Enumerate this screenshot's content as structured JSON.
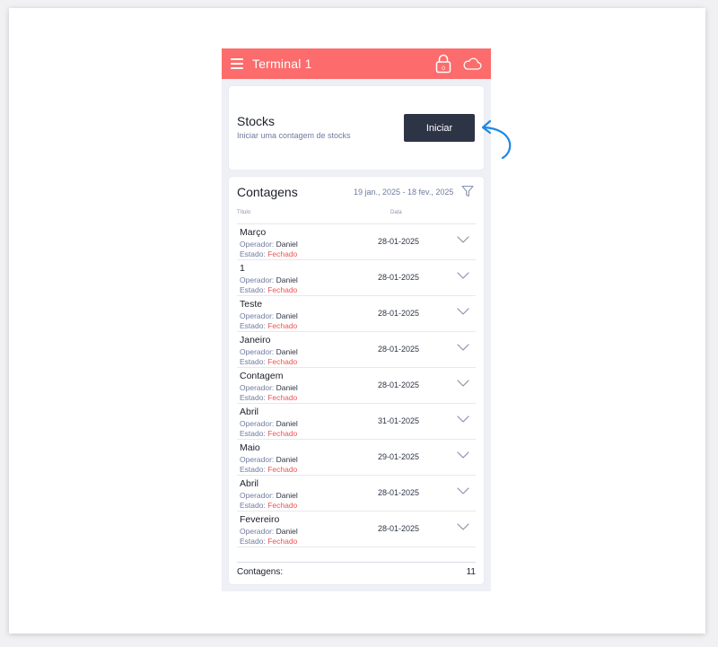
{
  "header": {
    "title": "Terminal 1",
    "lock_badge": "0"
  },
  "stocks": {
    "title": "Stocks",
    "subtitle": "Iniciar uma contagem de stocks",
    "start_label": "Iniciar"
  },
  "counts": {
    "title": "Contagens",
    "date_range": "19 jan., 2025 - 18 fev., 2025",
    "col_title": "Título",
    "col_date": "Data",
    "operator_label": "Operador:",
    "state_label": "Estado:",
    "rows": [
      {
        "title": "Março",
        "operator": "Daniel",
        "state": "Fechado",
        "date": "28-01-2025"
      },
      {
        "title": "1",
        "operator": "Daniel",
        "state": "Fechado",
        "date": "28-01-2025"
      },
      {
        "title": "Teste",
        "operator": "Daniel",
        "state": "Fechado",
        "date": "28-01-2025"
      },
      {
        "title": "Janeiro",
        "operator": "Daniel",
        "state": "Fechado",
        "date": "28-01-2025"
      },
      {
        "title": "Contagem",
        "operator": "Daniel",
        "state": "Fechado",
        "date": "28-01-2025"
      },
      {
        "title": "Abril",
        "operator": "Daniel",
        "state": "Fechado",
        "date": "31-01-2025"
      },
      {
        "title": "Maio",
        "operator": "Daniel",
        "state": "Fechado",
        "date": "29-01-2025"
      },
      {
        "title": "Abril",
        "operator": "Daniel",
        "state": "Fechado",
        "date": "28-01-2025"
      },
      {
        "title": "Fevereiro",
        "operator": "Daniel",
        "state": "Fechado",
        "date": "28-01-2025"
      }
    ],
    "footer_label": "Contagens:",
    "footer_count": "11"
  },
  "colors": {
    "header": "#fc6c6c",
    "button": "#2d3446",
    "closed": "#f05252",
    "arrow": "#1e88e5"
  },
  "icons": [
    "menu-icon",
    "lock-icon",
    "cloud-icon",
    "filter-icon",
    "chevron-down-icon",
    "curved-arrow-icon"
  ]
}
